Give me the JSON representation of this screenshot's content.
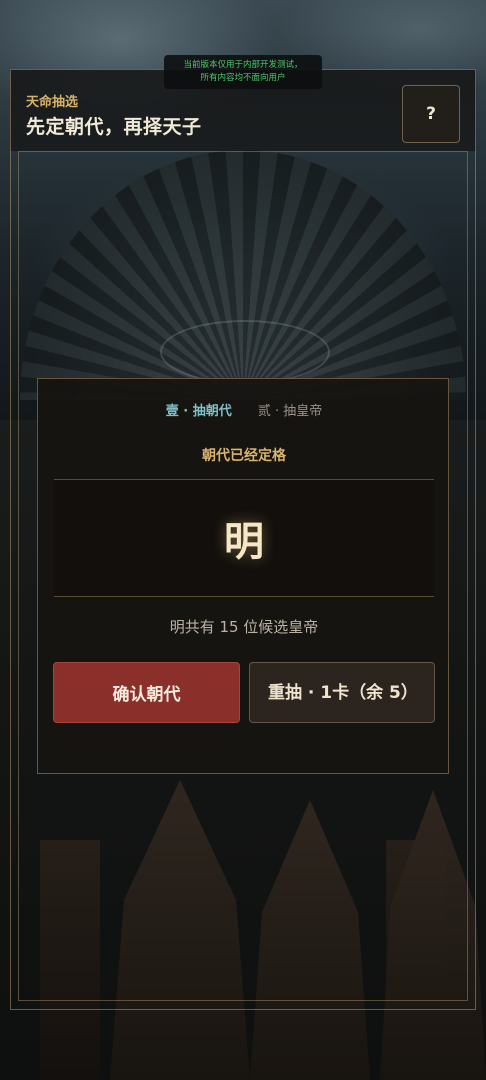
{
  "notice": {
    "line1": "当前版本仅用于内部开发测试，",
    "line2": "所有内容均不面向用户"
  },
  "header": {
    "subtitle": "天命抽选",
    "title": "先定朝代，再择天子",
    "help_label": "?"
  },
  "card": {
    "steps": [
      {
        "label": "壹 · 抽朝代",
        "active": true
      },
      {
        "label": "贰 · 抽皇帝",
        "active": false
      }
    ],
    "status": "朝代已经定格",
    "dynasty": "明",
    "candidate_count": "明共有 15 位候选皇帝",
    "confirm_label": "确认朝代",
    "reroll_label": "重抽 · 1卡（余 5）"
  },
  "colors": {
    "accent_gold": "#d8b26f",
    "step_active": "#7cc0c6",
    "confirm_red": "#8b2f2a",
    "notice_green": "#4fc86a"
  }
}
